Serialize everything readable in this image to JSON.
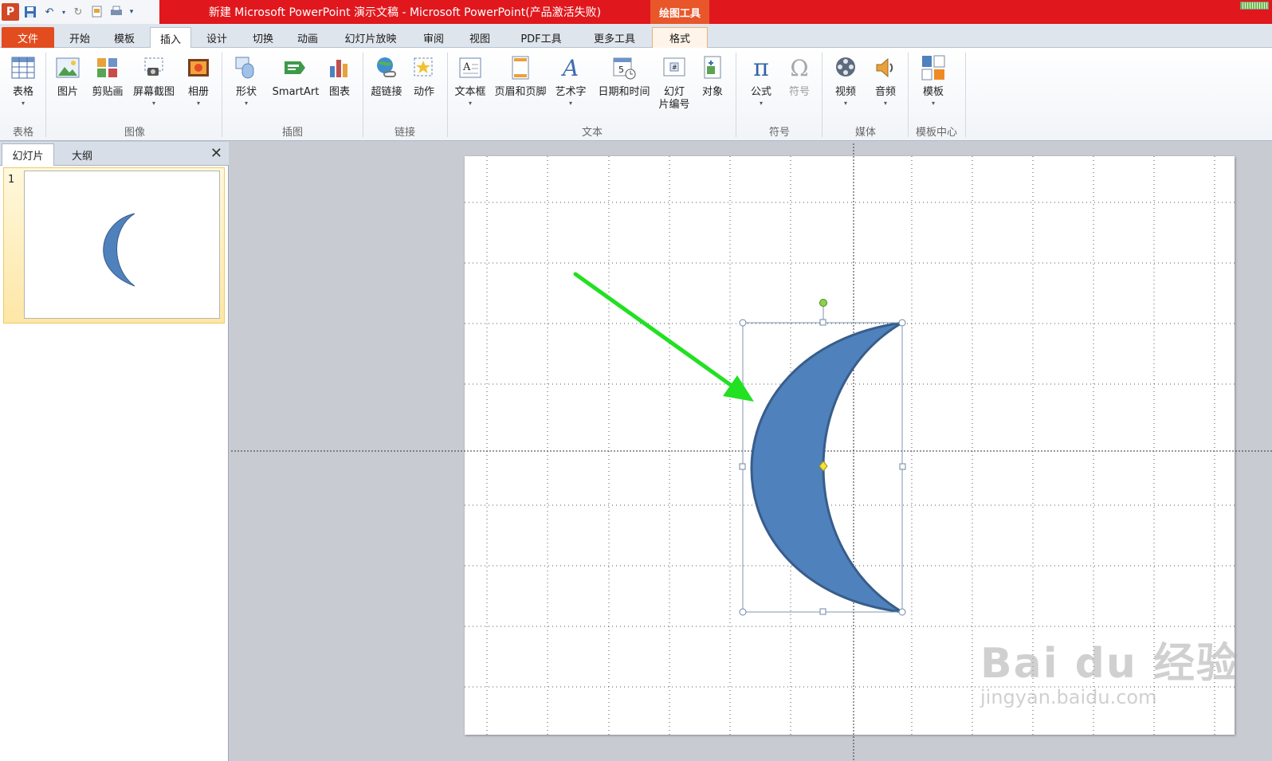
{
  "window": {
    "title": "新建 Microsoft PowerPoint 演示文稿 - Microsoft PowerPoint(产品激活失败)",
    "contextual_tab_group": "绘图工具",
    "app_logo": "P"
  },
  "quick_access": {
    "icons": [
      "save-icon",
      "undo-icon",
      "redo-icon",
      "new-slide-icon",
      "customize-icon"
    ]
  },
  "tabs": [
    {
      "id": "file",
      "label": "文件"
    },
    {
      "id": "home",
      "label": "开始"
    },
    {
      "id": "template",
      "label": "模板"
    },
    {
      "id": "insert",
      "label": "插入",
      "active": true
    },
    {
      "id": "design",
      "label": "设计"
    },
    {
      "id": "transitions",
      "label": "切换"
    },
    {
      "id": "animations",
      "label": "动画"
    },
    {
      "id": "slideshow",
      "label": "幻灯片放映"
    },
    {
      "id": "review",
      "label": "审阅"
    },
    {
      "id": "view",
      "label": "视图"
    },
    {
      "id": "pdf",
      "label": "PDF工具"
    },
    {
      "id": "more",
      "label": "更多工具"
    },
    {
      "id": "format",
      "label": "格式"
    }
  ],
  "ribbon": {
    "buttons": {
      "table": "表格",
      "picture": "图片",
      "clipart": "剪贴画",
      "screenshot": "屏幕截图",
      "album": "相册",
      "shapes": "形状",
      "smartart": "SmartArt",
      "chart": "图表",
      "hyperlink": "超链接",
      "action": "动作",
      "textbox": "文本框",
      "headerfooter": "页眉和页脚",
      "wordart": "艺术字",
      "datetime": "日期和时间",
      "slidenumber_1": "幻灯",
      "slidenumber_2": "片编号",
      "object": "对象",
      "equation": "公式",
      "symbol": "符号",
      "video": "视频",
      "audio": "音频",
      "templates": "模板"
    },
    "groups": {
      "tables": "表格",
      "images": "图像",
      "illustrations": "插图",
      "links": "链接",
      "text": "文本",
      "symbols": "符号",
      "media": "媒体",
      "template_center": "模板中心"
    }
  },
  "left_panel": {
    "tab_slides": "幻灯片",
    "tab_outline": "大纲",
    "close_glyph": "✕",
    "slide_number": "1"
  },
  "colors": {
    "moon_fill": "#4f81bd",
    "moon_stroke": "#385d8a",
    "arrow": "#22e022",
    "title_red": "#e0181e",
    "file_tab": "#e24c1f"
  },
  "watermark": {
    "brand": "Bai du 经验",
    "url": "jingyan.baidu.com"
  }
}
